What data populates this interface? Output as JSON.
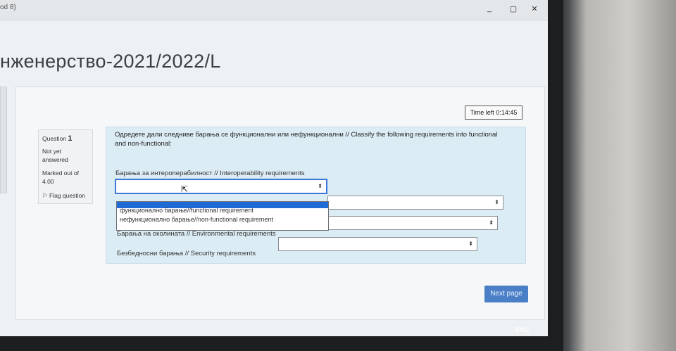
{
  "window": {
    "tab_title": "od 8)",
    "minimize": "_",
    "maximize": "▢",
    "close": "✕"
  },
  "course_title": "нженерство-2021/2022/L",
  "timer": "Time left 0:14:45",
  "question_info": {
    "label": "Question",
    "number": "1",
    "state": "Not yet answered",
    "marked": "Marked out of 4.00",
    "flag": "Flag question"
  },
  "question_text": {
    "line1": "Одредете дали следниве барања се функционални или нефункционални // Classify the following requirements into functional",
    "line2": "and non-functional:"
  },
  "items": [
    {
      "label": "Барања за интероперабилност // Interoperability requirements",
      "value": ""
    },
    {
      "label": "",
      "value": ""
    },
    {
      "label": "Барања на околината // Environmental requirements",
      "value": ""
    },
    {
      "label": "Безбедносни барања // Security requirements",
      "value": ""
    }
  ],
  "dropdown_options": [
    "функционално барање//functional requirement",
    "нефункционално барање//non-functional requirement"
  ],
  "next_button": "Next page",
  "taskbar": {
    "lang": "ENG"
  }
}
